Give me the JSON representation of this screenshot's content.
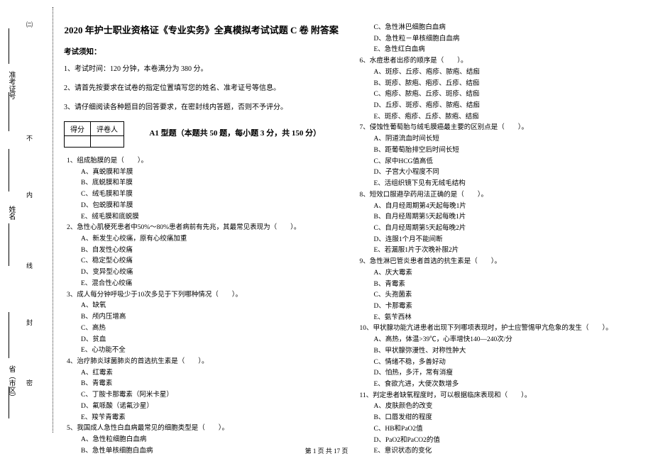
{
  "binding_marks": [
    "㈡",
    "密",
    "封",
    "线",
    "内",
    "不"
  ],
  "side_labels": {
    "province": "省（市区）",
    "name": "姓名",
    "ticket": "准考证号"
  },
  "title": "2020 年护士职业资格证《专业实务》全真模拟考试试题 C 卷  附答案",
  "notice_header": "考试须知：",
  "notices": [
    "1、考试时间：120 分钟，本卷满分为 380 分。",
    "2、请首先按要求在试卷的指定位置填写您的姓名、准考证号等信息。",
    "3、请仔细阅读各种题目的回答要求，在密封线内答题，否则不予评分。"
  ],
  "score_header": {
    "c1": "得分",
    "c2": "评卷人"
  },
  "section_title": "A1 型题（本题共 50 题，每小题 3 分，共 150 分）",
  "col1": [
    {
      "stem": "1、组成胎膜的是（　　）。",
      "opts": [
        "A、真蜕膜和羊膜",
        "B、底蜕膜和羊膜",
        "C、绒毛膜和羊膜",
        "D、包蜕膜和羊膜",
        "E、绒毛膜和底蜕膜"
      ]
    },
    {
      "stem": "2、急性心肌梗死患者中50%～80%患者病前有先兆，其最常见表现为（　　）。",
      "opts": [
        "A、新发生心绞痛，原有心绞痛加重",
        "B、自发性心绞痛",
        "C、稳定型心绞痛",
        "D、变异型心绞痛",
        "E、混合性心绞痛"
      ]
    },
    {
      "stem": "3、成人每分钟呼吸少于10次多见于下列哪种情况（　　）。",
      "opts": [
        "A、缺氧",
        "B、颅内压增高",
        "C、高热",
        "D、贫血",
        "E、心功能不全"
      ]
    },
    {
      "stem": "4、治疗肺炎球菌肺炎的首选抗生素是（　　）。",
      "opts": [
        "A、红霉素",
        "B、青霉素",
        "C、丁胺卡那霉素（阿米卡星）",
        "D、氟哌酸（诺氟沙星）",
        "E、羧苄青霉素"
      ]
    },
    {
      "stem": "5、我国成人急性白血病最常见的细胞类型是（　　）。",
      "opts": [
        "A、急性粒细胞白血病",
        "B、急性单核细胞白血病"
      ]
    }
  ],
  "col2_pre": [
    "C、急性淋巴细胞白血病",
    "D、急性粒－单核细胞白血病",
    "E、急性红白血病"
  ],
  "col2": [
    {
      "stem": "6、水痘患者出疹的顺序是（　　）。",
      "opts": [
        "A、斑疹、丘疹、疱疹、脓疱、结痂",
        "B、斑疹、脓疱、疱疹、丘疹、结痂",
        "C、疱疹、脓疱、丘疹、斑疹、结痂",
        "D、丘疹、斑疹、疱疹、脓疱、结痂",
        "E、斑疹、疱疹、丘疹、脓疱、结痂"
      ]
    },
    {
      "stem": "7、侵蚀性葡萄胎与绒毛膜癌最主要的区别点是（　　）。",
      "opts": [
        "A、阴道流血时间长短",
        "B、距葡萄胎排空后时间长短",
        "C、尿中HCG值高低",
        "D、子宫大小程度不同",
        "E、活组织镜下见有无绒毛结构"
      ]
    },
    {
      "stem": "8、短效口服避孕药用法正确的是（　　）。",
      "opts": [
        "A、自月经周期第4天起每晚1片",
        "B、自月经周期第5天起每晚1片",
        "C、自月经周期第5天起每晚2片",
        "D、连服1个月不能间断",
        "E、若漏服1片于次晚补服2片"
      ]
    },
    {
      "stem": "9、急性淋巴管炎患者首选的抗生素是（　　）。",
      "opts": [
        "A、庆大霉素",
        "B、青霉素",
        "C、头孢菌素",
        "D、卡那霉素",
        "E、氨苄西林"
      ]
    },
    {
      "stem": "10、甲状腺功能亢进患者出现下列哪项表现时，护士应警惕甲亢危象的发生（　　）。",
      "opts": [
        "A、高热，体温>39℃，心率增快140—240次/分",
        "B、甲状腺弥漫性、对称性肿大",
        "C、情绪不稳，多善好动",
        "D、怕热，多汗，常有消瘦",
        "E、食欲亢进，大便次数增多"
      ]
    },
    {
      "stem": "11、判定患者缺氧程度时，可以根据临床表现和（　　）。",
      "opts": [
        "A、皮肤颜色的改变",
        "B、口唇发绀的程度",
        "C、HB和PaO2值",
        "D、PaO2和PaCO2的值",
        "E、意识状态的变化"
      ]
    }
  ],
  "footer": "第 1 页 共 17 页"
}
